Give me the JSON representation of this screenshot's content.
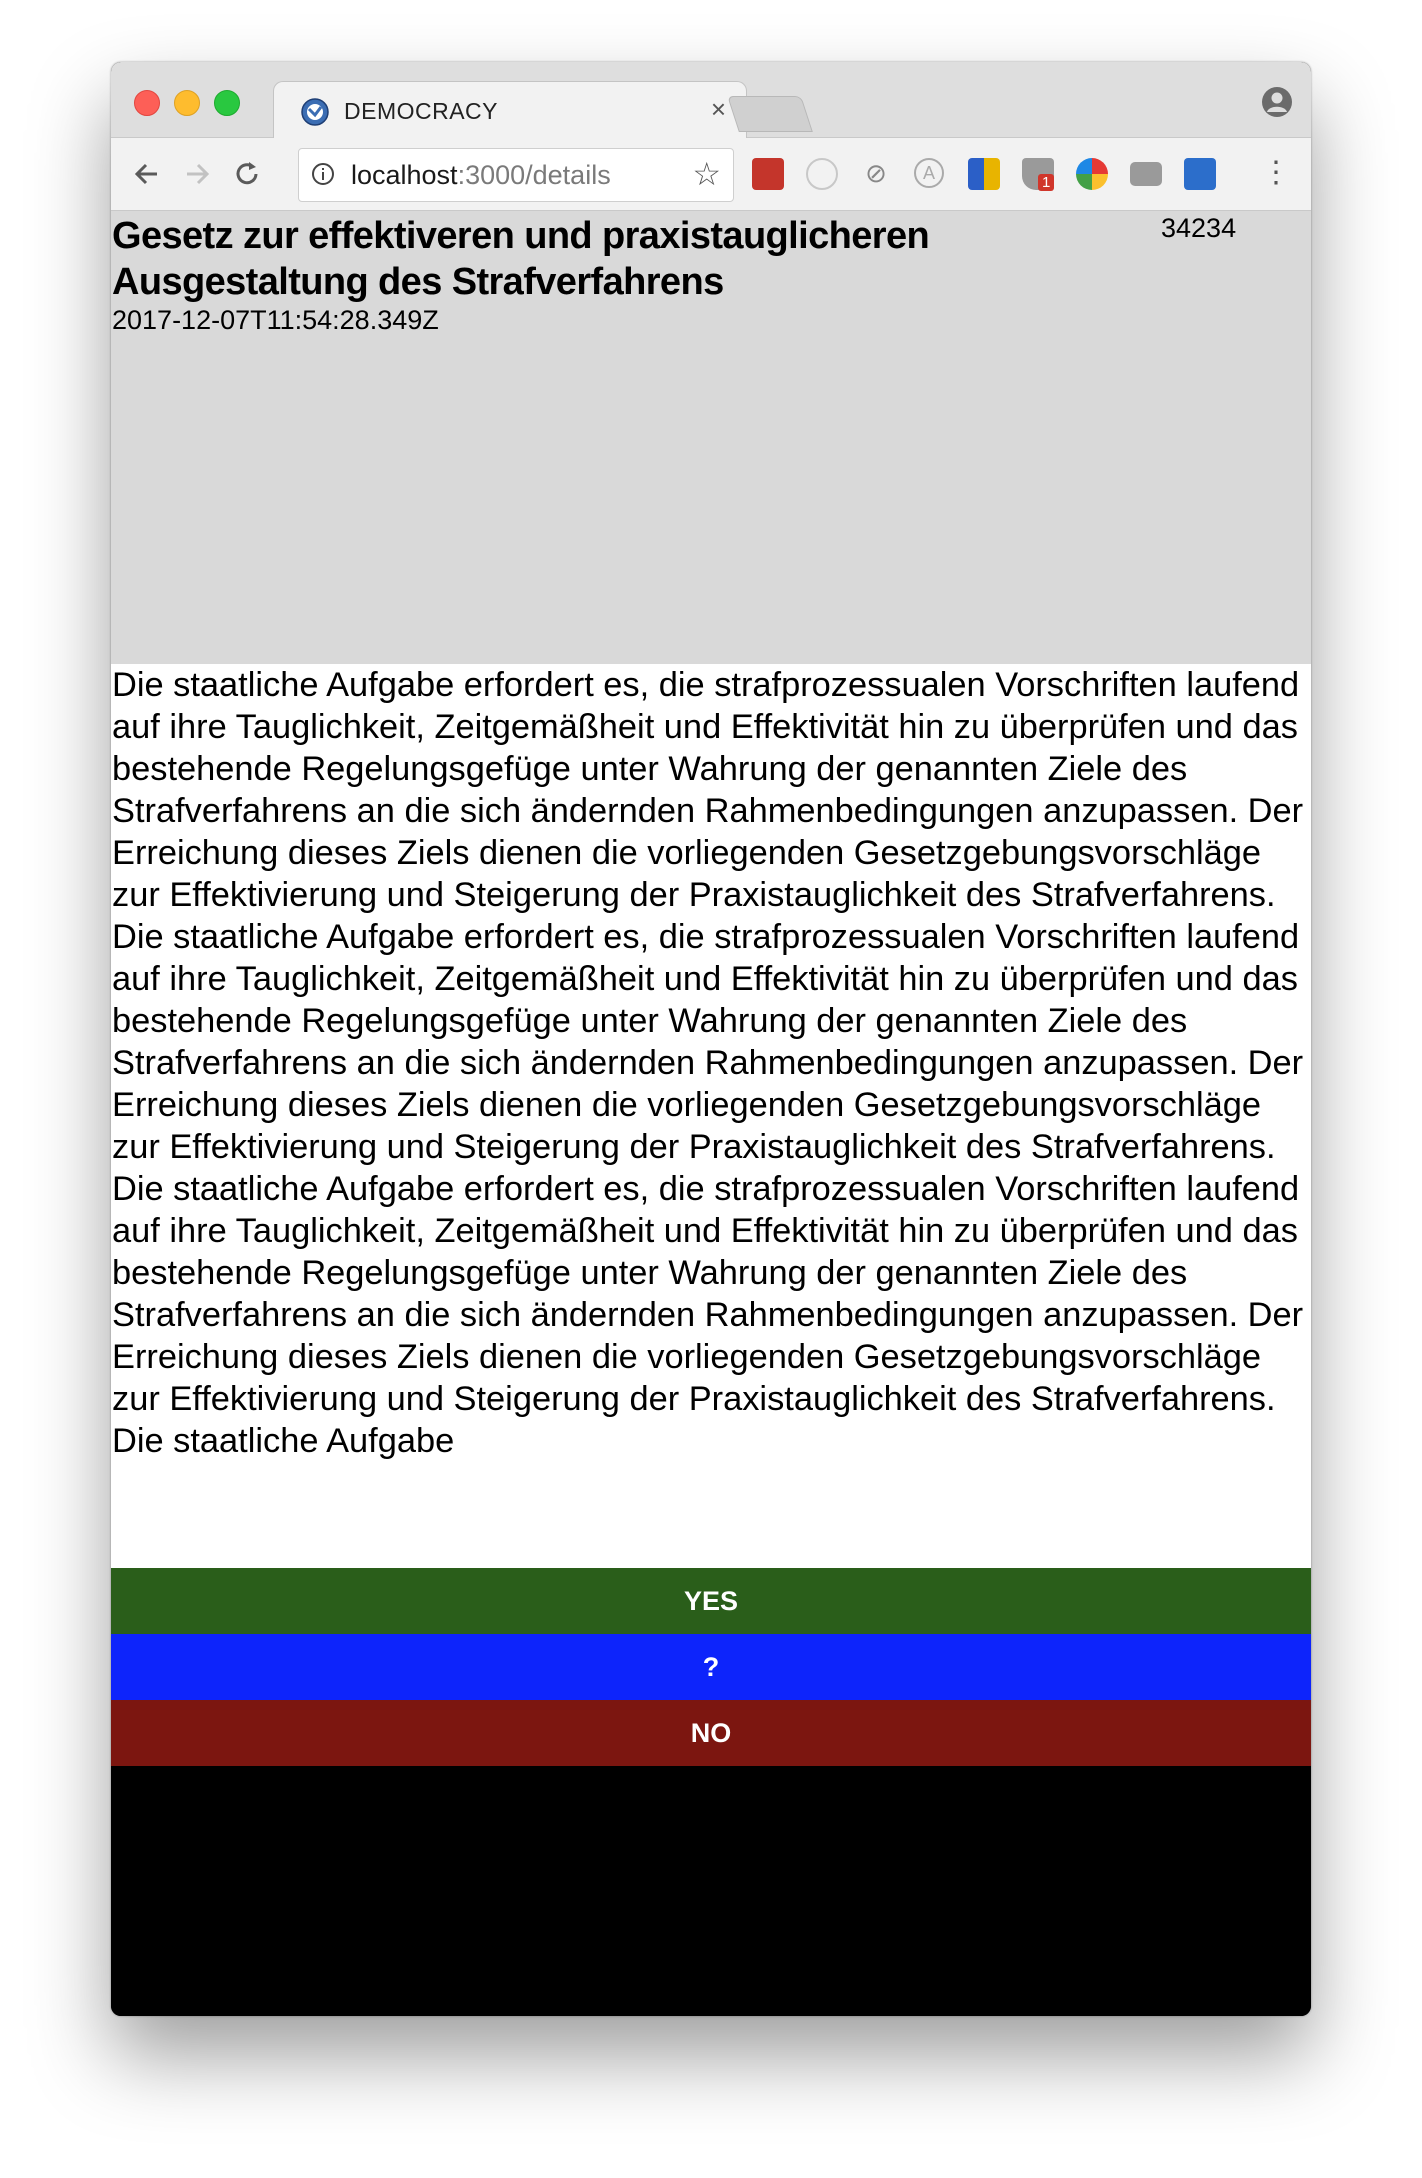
{
  "browser": {
    "tab_title": "DEMOCRACY",
    "tab_close": "×",
    "url_host": "localhost",
    "url_rest": ":3000/details",
    "badge_count": "1"
  },
  "icons": {
    "back": "back-arrow-icon",
    "forward": "forward-arrow-icon",
    "reload": "reload-icon",
    "info": "info-icon",
    "bookmark": "bookmark-star-icon",
    "profile": "profile-icon",
    "menu": "menu-dots-icon"
  },
  "colors": {
    "header_bg": "#d9d9d9",
    "yes": "#2a5e1a",
    "abstain": "#0d24fb",
    "no": "#7c1610",
    "footer_bg": "#000000"
  },
  "details": {
    "title": "Gesetz zur effektiveren und praxistauglicheren Ausgestaltung des Strafverfahrens",
    "date": "2017-12-07T11:54:28.349Z",
    "count": "34234",
    "text": "Die staatliche Aufgabe erfordert es, die strafprozessualen Vorschriften laufend auf ihre Tauglichkeit, Zeitgemäßheit und Effektivität hin zu überprüfen und das bestehende Regelungsgefüge unter Wahrung der genannten Ziele des Strafverfahrens an die sich ändernden Rahmenbedingungen anzupassen. Der Erreichung dieses Ziels dienen die vorliegenden Gesetzgebungsvorschläge zur Effektivierung und Steigerung der Praxistauglichkeit des Strafverfahrens. Die staatliche Aufgabe erfordert es, die strafprozessualen Vorschriften laufend auf ihre Tauglichkeit, Zeitgemäßheit und Effektivität hin zu überprüfen und das bestehende Regelungsgefüge unter Wahrung der genannten Ziele des Strafverfahrens an die sich ändernden Rahmenbedingungen anzupassen. Der Erreichung dieses Ziels dienen die vorliegenden Gesetzgebungsvorschläge zur Effektivierung und Steigerung der Praxistauglichkeit des Strafverfahrens. Die staatliche Aufgabe erfordert es, die strafprozessualen Vorschriften laufend auf ihre Tauglichkeit, Zeitgemäßheit und Effektivität hin zu überprüfen und das bestehende Regelungsgefüge unter Wahrung der genannten Ziele des Strafverfahrens an die sich ändernden Rahmenbedingungen anzupassen. Der Erreichung dieses Ziels dienen die vorliegenden Gesetzgebungsvorschläge zur Effektivierung und Steigerung der Praxistauglichkeit des Strafverfahrens. Die staatliche Aufgabe"
  },
  "vote": {
    "yes": "YES",
    "abstain": "?",
    "no": "NO"
  }
}
